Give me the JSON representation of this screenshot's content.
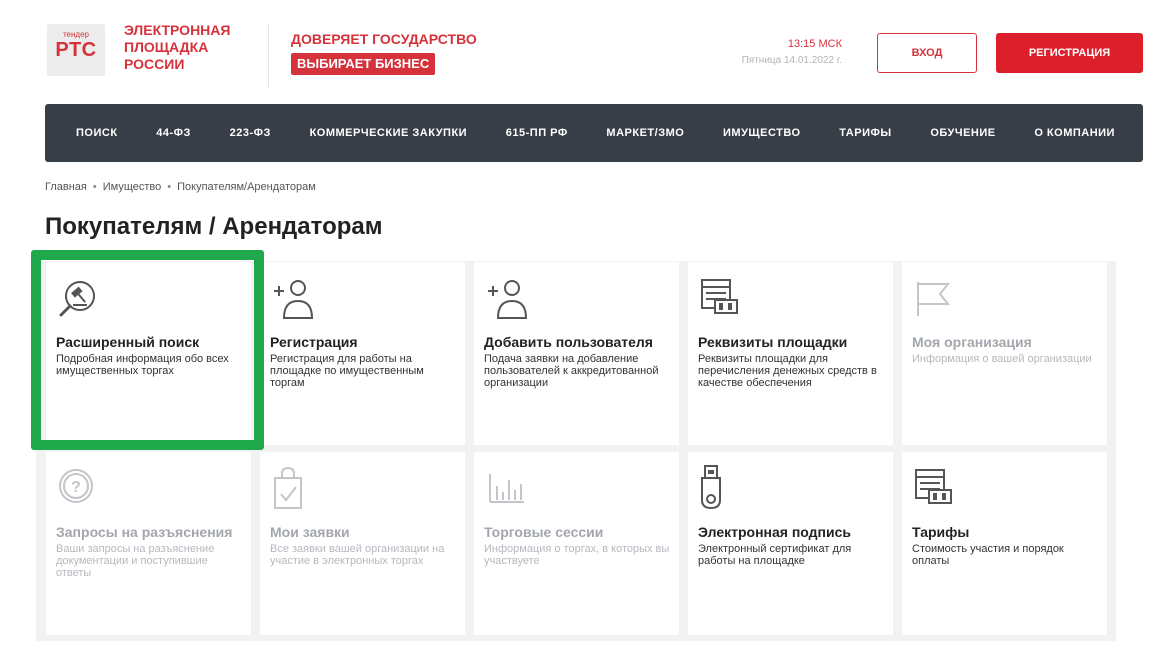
{
  "header": {
    "logo_small": "тендер",
    "logo_big": "РТС",
    "logo_lines": [
      "ЭЛЕКТРОННАЯ",
      "ПЛОЩАДКА",
      "РОССИИ"
    ],
    "slogan_top": "ДОВЕРЯЕТ ГОСУДАРСТВО",
    "slogan_bottom": "ВЫБИРАЕТ БИЗНЕС",
    "time": "13:15 МСК",
    "date": "Пятница 14.01.2022 г.",
    "login_label": "ВХОД",
    "register_label": "РЕГИСТРАЦИЯ"
  },
  "nav": {
    "items": [
      "ПОИСК",
      "44-ФЗ",
      "223-ФЗ",
      "КОММЕРЧЕСКИЕ ЗАКУПКИ",
      "615-ПП РФ",
      "МАРКЕТ/ЗМО",
      "ИМУЩЕСТВО",
      "ТАРИФЫ",
      "ОБУЧЕНИЕ",
      "О КОМПАНИИ"
    ]
  },
  "breadcrumb": [
    "Главная",
    "Имущество",
    "Покупателям/Арендаторам"
  ],
  "page_title": "Покупателям / Арендаторам",
  "tiles": [
    {
      "title": "Расширенный поиск",
      "desc": "Подробная информация обо всех имущественных торгах",
      "icon": "search-gavel-icon",
      "state": "active"
    },
    {
      "title": "Регистрация",
      "desc": "Регистрация для работы на площадке по имущественным торгам",
      "icon": "add-user-icon",
      "state": "active"
    },
    {
      "title": "Добавить пользователя",
      "desc": "Подача заявки на добавление пользователей к аккредитованной организации",
      "icon": "add-user-icon",
      "state": "active"
    },
    {
      "title": "Реквизиты площадки",
      "desc": "Реквизиты площадки для перечисления денежных средств в качестве обеспечения",
      "icon": "requisites-icon",
      "state": "active"
    },
    {
      "title": "Моя организация",
      "desc": "Информация о вашей организации",
      "icon": "flag-icon",
      "state": "muted"
    },
    {
      "title": "Запросы на разъяснения",
      "desc": "Ваши запросы на разъяснение документации и поступившие ответы",
      "icon": "question-icon",
      "state": "muted"
    },
    {
      "title": "Мои заявки",
      "desc": "Все заявки вашей организации на участие в электронных торгах",
      "icon": "shopping-bag-check-icon",
      "state": "muted"
    },
    {
      "title": "Торговые сессии",
      "desc": "Информация о торгах, в которых вы участвуете",
      "icon": "bar-chart-icon",
      "state": "muted"
    },
    {
      "title": "Электронная подпись",
      "desc": "Электронный сертификат для работы на площадке",
      "icon": "usb-token-icon",
      "state": "active"
    },
    {
      "title": "Тарифы",
      "desc": "Стоимость участия и порядок оплаты",
      "icon": "requisites-icon",
      "state": "active"
    }
  ],
  "colors": {
    "brand_red": "#d5323b",
    "nav_bg": "#383e47",
    "highlight_green": "#1fa84c",
    "icon_active": "#555555",
    "icon_muted": "#c2c5c9"
  }
}
